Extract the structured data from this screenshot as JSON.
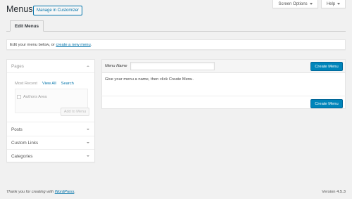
{
  "top_tabs": {
    "screen_options": "Screen Options",
    "help": "Help"
  },
  "header": {
    "title": "Menus",
    "customizer_button": "Manage in Customizer"
  },
  "nav_tabs": [
    {
      "label": "Edit Menus",
      "active": true
    }
  ],
  "manage": {
    "text": "Edit your menu below, or ",
    "link": "create a new menu",
    "suffix": "."
  },
  "sidebar": {
    "pages": {
      "title": "Pages",
      "tabs": [
        "Most Recent",
        "View All",
        "Search"
      ],
      "active_tab": "Most Recent",
      "items": [
        "Authors Area"
      ],
      "add_button": "Add to Menu"
    },
    "sections": [
      "Posts",
      "Custom Links",
      "Categories"
    ]
  },
  "menu_editor": {
    "name_label": "Menu Name",
    "name_value": "",
    "create_button": "Create Menu",
    "instructions": "Give your menu a name, then click Create Menu."
  },
  "footer": {
    "thanks_text": "Thank you for creating with ",
    "thanks_link": "WordPress",
    "thanks_suffix": ".",
    "version": "Version 4.5.3"
  },
  "colors": {
    "accent": "#0073aa",
    "primary_button": "#0085ba",
    "background": "#f1f1f1"
  }
}
